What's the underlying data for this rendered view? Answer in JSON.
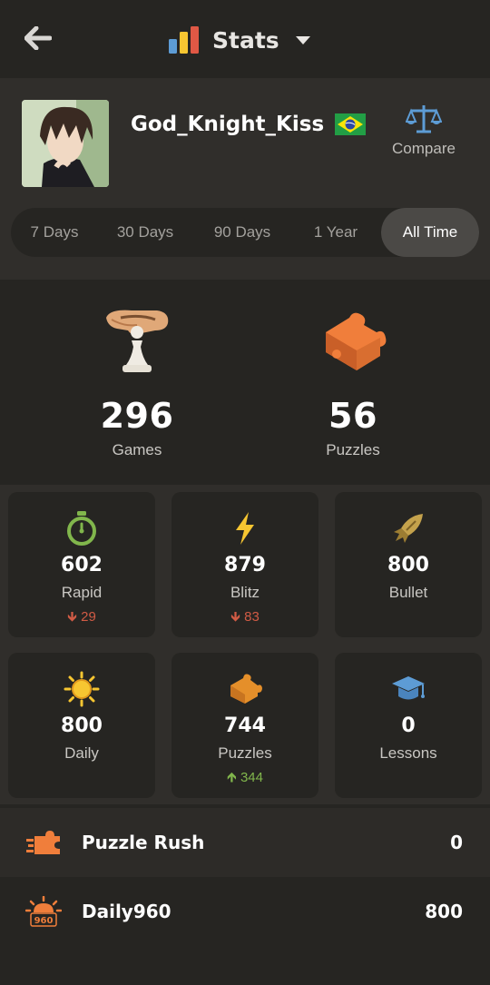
{
  "header": {
    "title": "Stats",
    "icons": {
      "back": "arrow-left-icon",
      "stats": "bar-chart-icon",
      "dropdown": "caret-down-icon"
    }
  },
  "profile": {
    "username": "God_Knight_Kiss",
    "country_flag": "brazil-flag-icon",
    "compare_label": "Compare"
  },
  "time_ranges": {
    "options": [
      "7 Days",
      "30 Days",
      "90 Days",
      "1 Year",
      "All Time"
    ],
    "selected": "All Time"
  },
  "summary": {
    "games": {
      "value": "296",
      "label": "Games",
      "icon": "pawn-hand-icon"
    },
    "puzzles": {
      "value": "56",
      "label": "Puzzles",
      "icon": "puzzle-piece-icon"
    }
  },
  "ratings": [
    {
      "value": "602",
      "label": "Rapid",
      "delta": "29",
      "delta_dir": "down",
      "icon": "stopwatch-icon",
      "color": "#81b64c"
    },
    {
      "value": "879",
      "label": "Blitz",
      "delta": "83",
      "delta_dir": "down",
      "icon": "lightning-icon",
      "color": "#f7c631"
    },
    {
      "value": "800",
      "label": "Bullet",
      "delta": "",
      "delta_dir": "",
      "icon": "bullet-icon",
      "color": "#c4a24c"
    },
    {
      "value": "800",
      "label": "Daily",
      "delta": "",
      "delta_dir": "",
      "icon": "sun-icon",
      "color": "#f7c631"
    },
    {
      "value": "744",
      "label": "Puzzles",
      "delta": "344",
      "delta_dir": "up",
      "icon": "puzzle-icon",
      "color": "#e58f2a"
    },
    {
      "value": "0",
      "label": "Lessons",
      "delta": "",
      "delta_dir": "",
      "icon": "graduation-cap-icon",
      "color": "#5d9cd5"
    }
  ],
  "modes": [
    {
      "label": "Puzzle Rush",
      "value": "0",
      "icon": "puzzle-rush-icon"
    },
    {
      "label": "Daily960",
      "value": "800",
      "icon": "daily960-icon",
      "badge": "960"
    }
  ],
  "colors": {
    "background": "#262522",
    "panel": "#302e2b",
    "accent_orange": "#f07e3b",
    "delta_down": "#d15b45",
    "delta_up": "#81b64c"
  }
}
